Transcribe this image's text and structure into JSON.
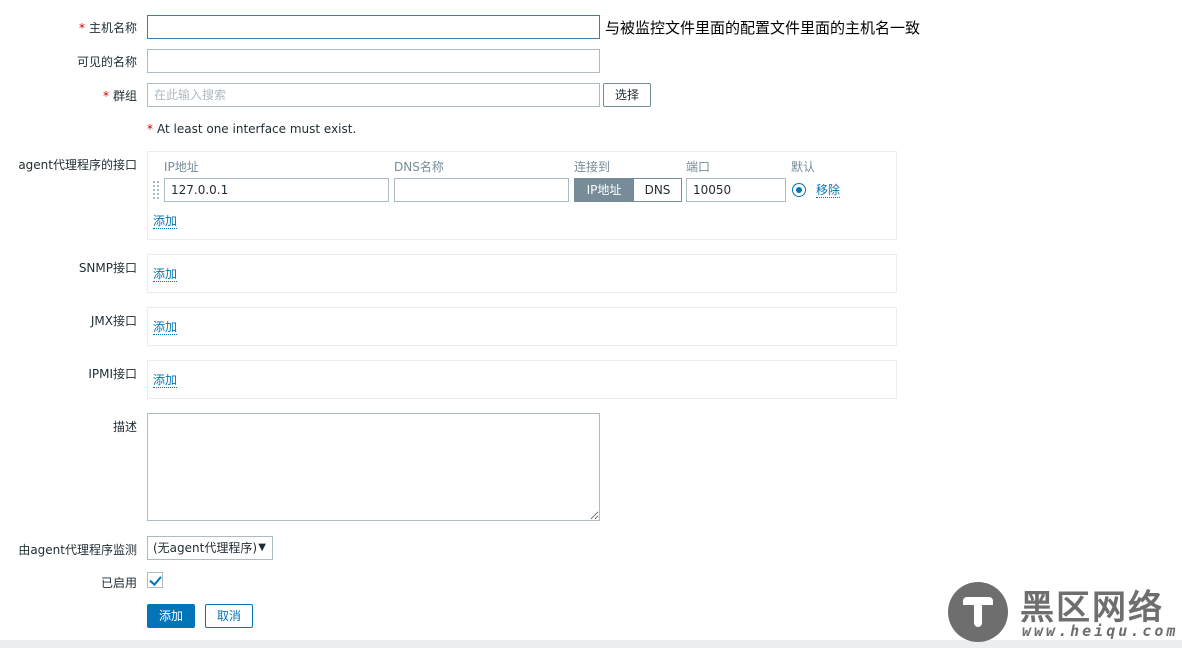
{
  "form": {
    "host_name": {
      "required_mark": "*",
      "label": "主机名称",
      "value": "",
      "note": "与被监控文件里面的配置文件里面的主机名一致"
    },
    "visible_name": {
      "label": "可见的名称",
      "value": ""
    },
    "groups": {
      "required_mark": "*",
      "label": "群组",
      "placeholder": "在此输入搜索",
      "select_button": "选择"
    },
    "interface_warning": {
      "mark": "*",
      "text": "At least one interface must exist."
    },
    "agent_interfaces": {
      "label": "agent代理程序的接口",
      "columns": {
        "ip": "IP地址",
        "dns": "DNS名称",
        "connect_to": "连接到",
        "port": "端口",
        "default": "默认"
      },
      "row": {
        "ip": "127.0.0.1",
        "dns": "",
        "connect_ip": "IP地址",
        "connect_dns": "DNS",
        "port": "10050",
        "default_selected": true,
        "remove": "移除"
      },
      "add": "添加"
    },
    "snmp": {
      "label": "SNMP接口",
      "add": "添加"
    },
    "jmx": {
      "label": "JMX接口",
      "add": "添加"
    },
    "ipmi": {
      "label": "IPMI接口",
      "add": "添加"
    },
    "description": {
      "label": "描述",
      "value": ""
    },
    "proxy": {
      "label": "由agent代理程序监测",
      "selected": "(无agent代理程序)"
    },
    "enabled": {
      "label": "已启用",
      "checked": true
    },
    "buttons": {
      "add": "添加",
      "cancel": "取消"
    }
  },
  "watermark": {
    "title": "黑区网络",
    "url": "www.heiqu.com"
  },
  "colors": {
    "accent": "#0275b8",
    "required": "#d40000",
    "muted": "#768d99",
    "border": "#acbbc2"
  }
}
